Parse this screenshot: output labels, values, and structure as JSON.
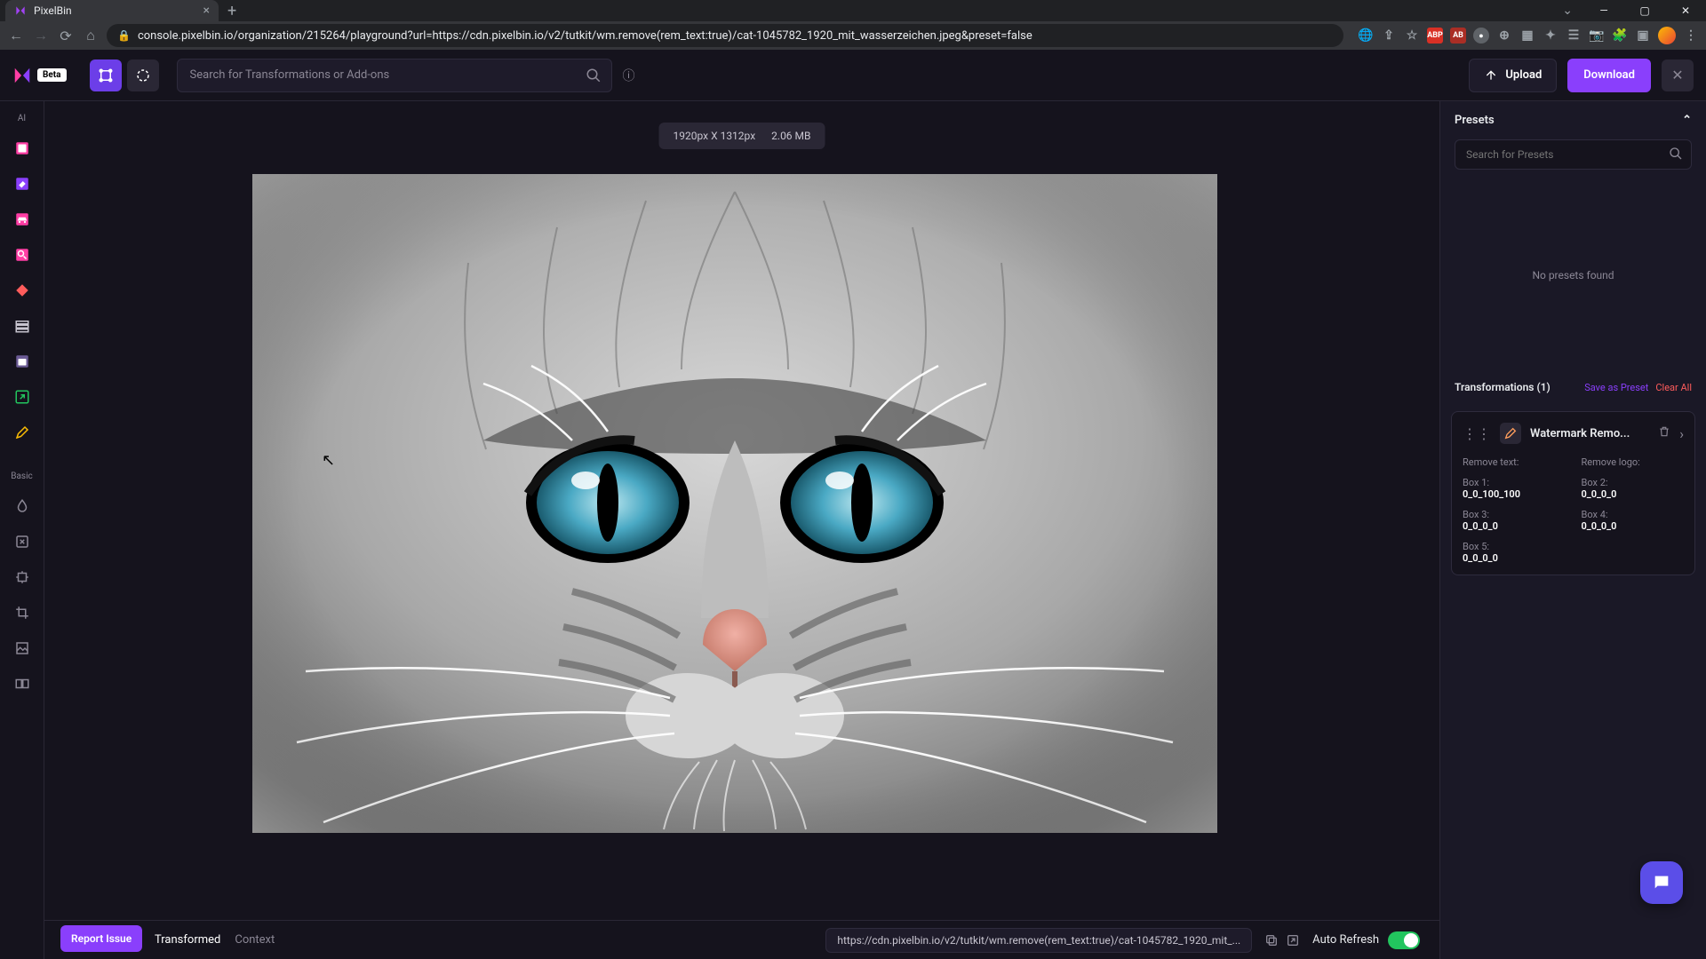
{
  "browser": {
    "tab_title": "PixelBin",
    "url": "console.pixelbin.io/organization/215264/playground?url=https://cdn.pixelbin.io/v2/tutkit/wm.remove(rem_text:true)/cat-1045782_1920_mit_wasserzeichen.jpeg&preset=false"
  },
  "header": {
    "beta": "Beta",
    "search_placeholder": "Search for Transformations or Add-ons",
    "upload": "Upload",
    "download": "Download"
  },
  "rail": {
    "section_ai": "AI",
    "section_basic": "Basic"
  },
  "canvas": {
    "dimensions": "1920px X 1312px",
    "filesize": "2.06 MB"
  },
  "bottom": {
    "report": "Report Issue",
    "tab_transformed": "Transformed",
    "tab_context": "Context",
    "url": "https://cdn.pixelbin.io/v2/tutkit/wm.remove(rem_text:true)/cat-1045782_1920_mit_...",
    "auto_refresh": "Auto Refresh"
  },
  "panel": {
    "presets_title": "Presets",
    "presets_search_placeholder": "Search for Presets",
    "no_presets": "No presets found",
    "transformations_title": "Transformations (1)",
    "save_preset": "Save as Preset",
    "clear_all": "Clear All",
    "card": {
      "name": "Watermark Remo...",
      "params": {
        "remove_text_label": "Remove text:",
        "remove_logo_label": "Remove logo:",
        "box1_label": "Box 1:",
        "box1_value": "0_0_100_100",
        "box2_label": "Box 2:",
        "box2_value": "0_0_0_0",
        "box3_label": "Box 3:",
        "box3_value": "0_0_0_0",
        "box4_label": "Box 4:",
        "box4_value": "0_0_0_0",
        "box5_label": "Box 5:",
        "box5_value": "0_0_0_0"
      }
    }
  }
}
